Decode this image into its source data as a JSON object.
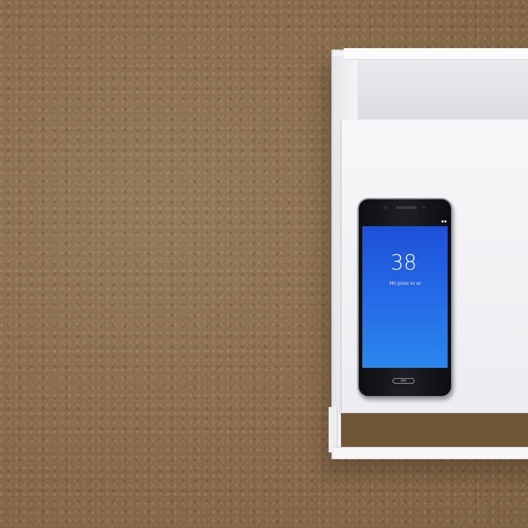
{
  "phone": {
    "clock_text": "38",
    "clock_suffix": "·",
    "date_line": "ЗЮ gzzеz ez ez",
    "status_text": "■■ ",
    "home_label": "ooo"
  },
  "colors": {
    "carpet": "#8a6f4c",
    "box": "#f2f2f4",
    "screen": "#2468e6",
    "phone_body": "#14161a"
  }
}
